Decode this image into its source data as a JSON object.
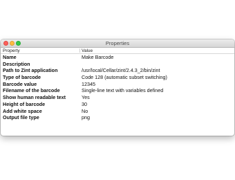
{
  "window": {
    "title": "Properties",
    "controls": {
      "close": "close",
      "minimize": "minimize",
      "zoom": "zoom"
    }
  },
  "table": {
    "columns": [
      "Property",
      "Value"
    ],
    "rows": [
      {
        "property": "Name",
        "value": "Make Barcode"
      },
      {
        "property": "Description",
        "value": ""
      },
      {
        "property": "Path to Zint application",
        "value": "/usr/local/Cellar/zint/2.4.3_2/bin/zint"
      },
      {
        "property": "Type of barcode",
        "value": "Code 128 (automatic subset switching)"
      },
      {
        "property": "Barcode value",
        "value": "12345"
      },
      {
        "property": "Filename of the barcode",
        "value": "Single-line text with variables defined"
      },
      {
        "property": "Show human readable text",
        "value": "Yes"
      },
      {
        "property": "Height of barcode",
        "value": "30"
      },
      {
        "property": "Add white space",
        "value": "No"
      },
      {
        "property": "Output file type",
        "value": "png"
      }
    ]
  },
  "colors": {
    "close": "#fc605b",
    "minimize": "#fdbc40",
    "zoom": "#34c84a",
    "titlebar": "#dcdcdc"
  }
}
